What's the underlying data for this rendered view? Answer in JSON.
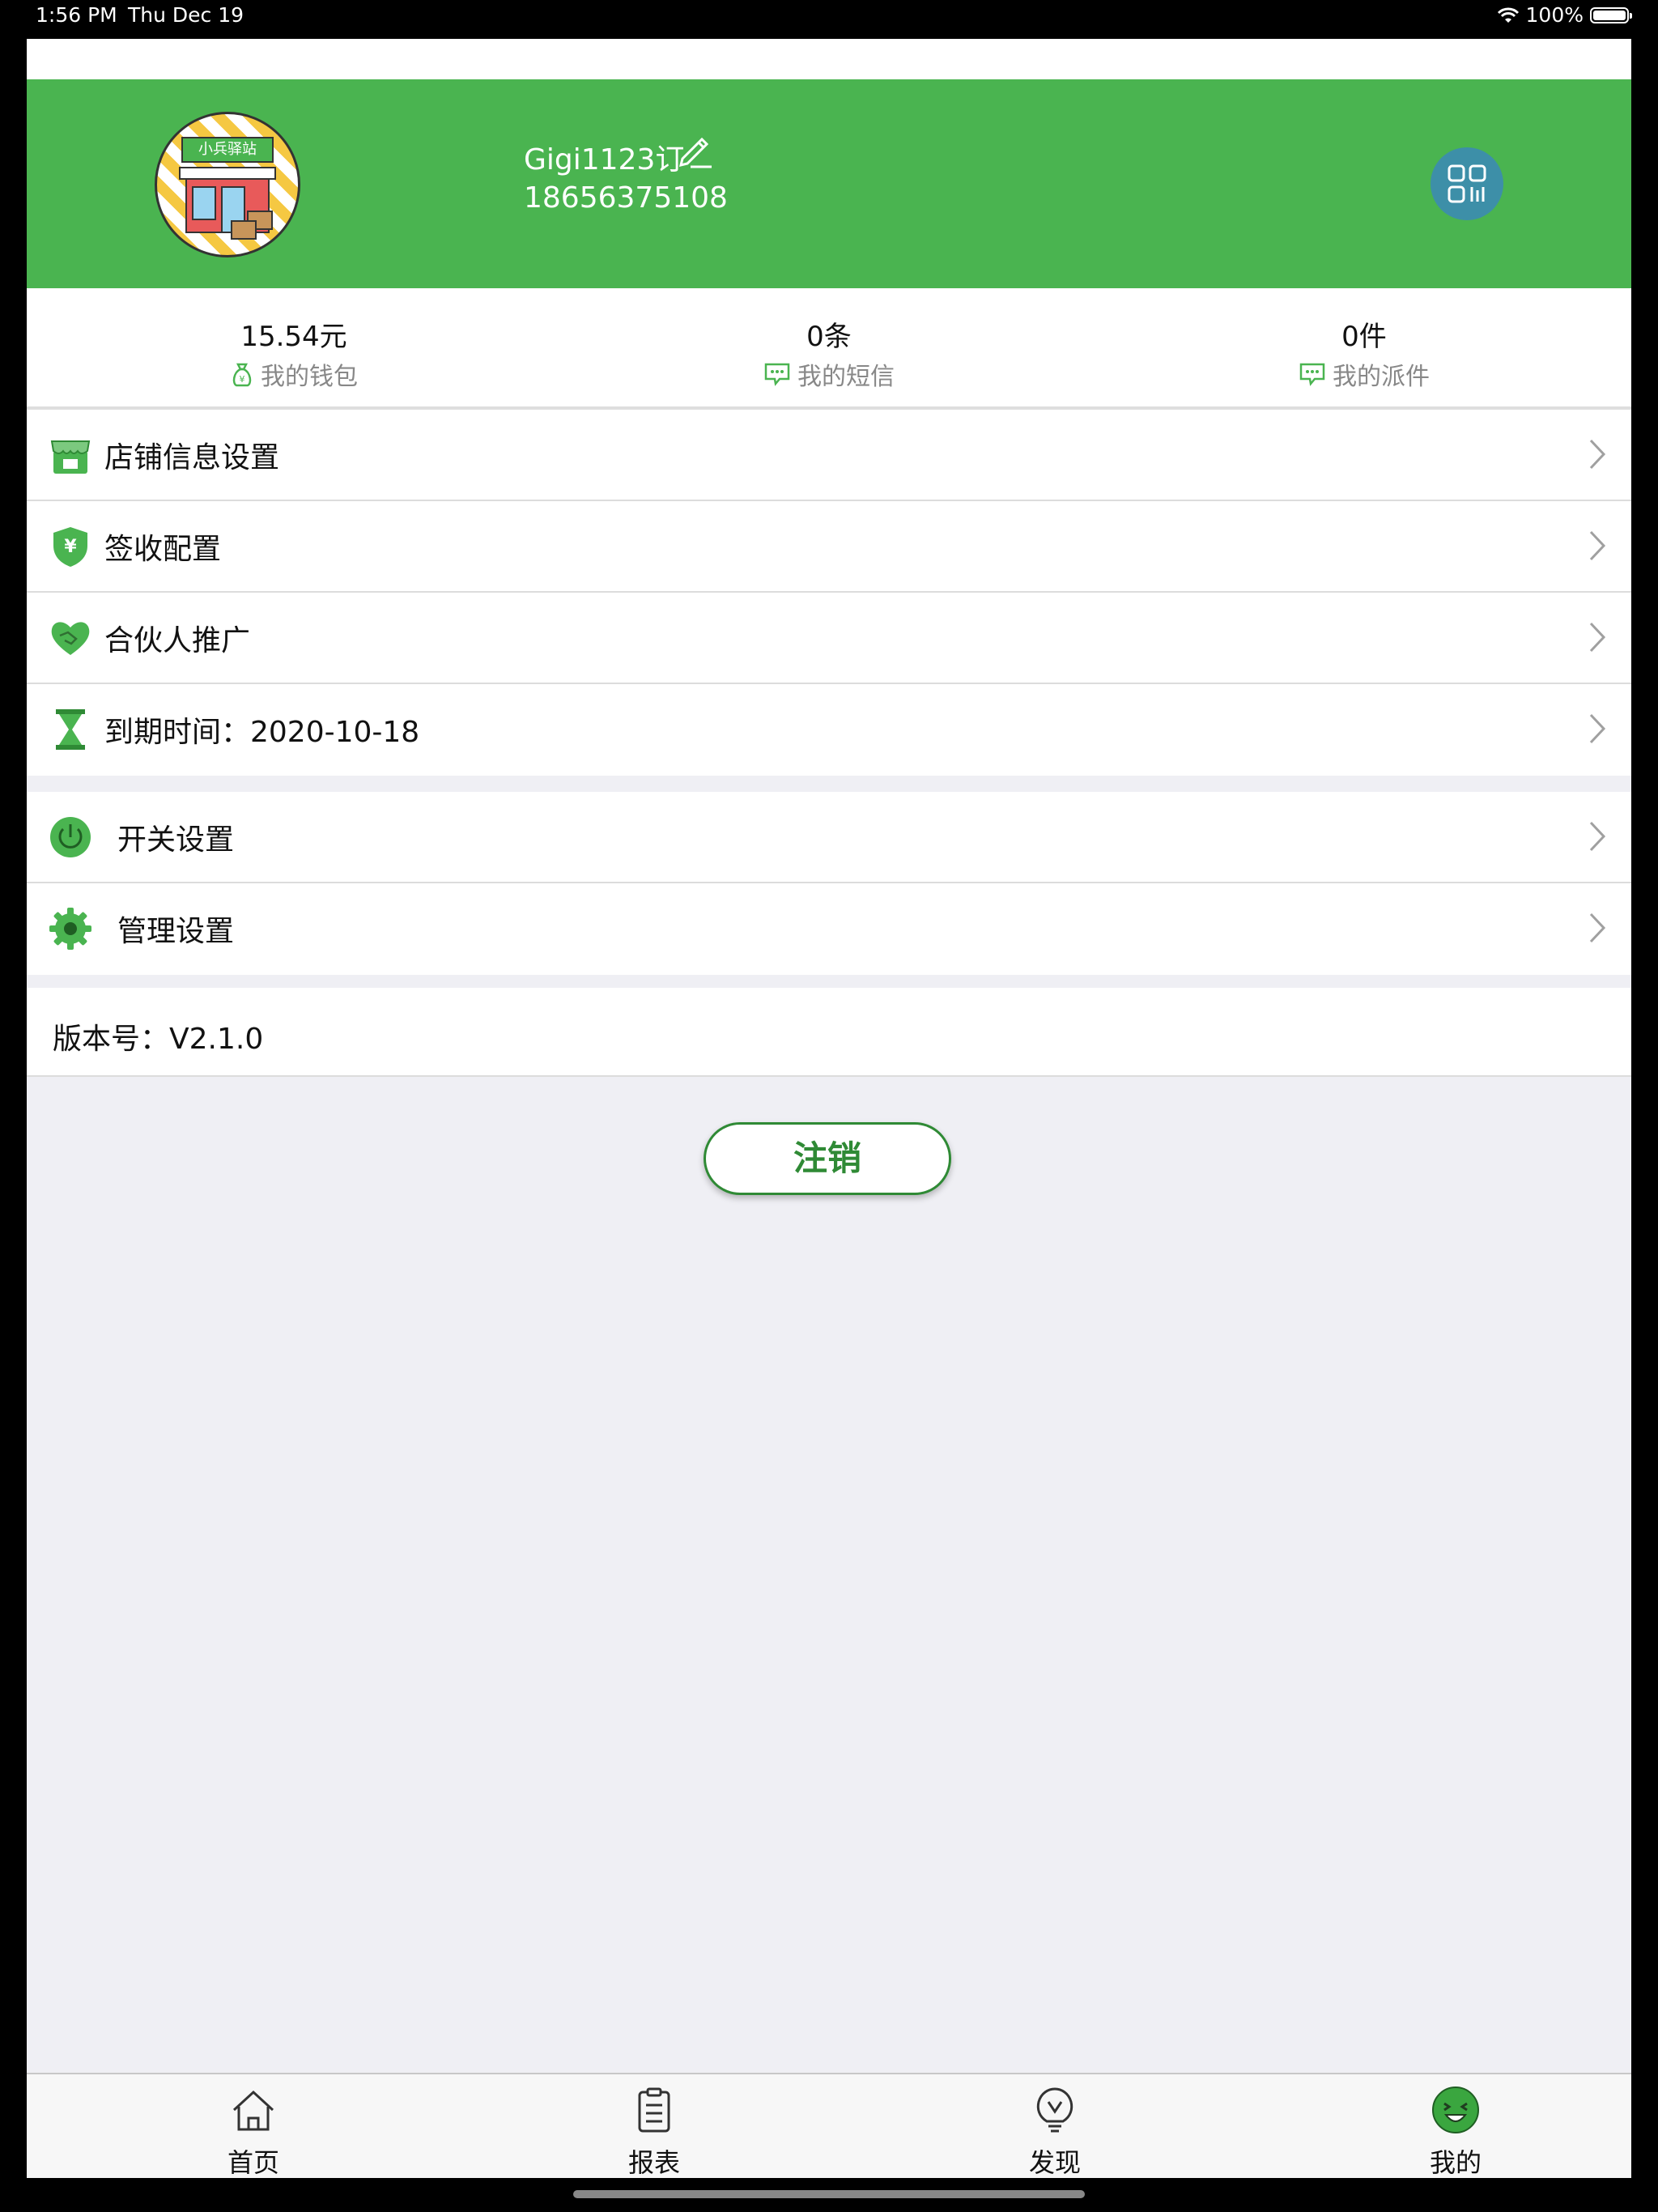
{
  "status_bar": {
    "time": "1:56 PM",
    "date": "Thu Dec 19",
    "battery": "100%"
  },
  "profile": {
    "avatar_text": "小兵驿站",
    "name": "Gigi1123订",
    "phone": "18656375108"
  },
  "stats": [
    {
      "value": "15.54元",
      "label": "我的钱包",
      "icon": "money-bag-icon"
    },
    {
      "value": "0条",
      "label": "我的短信",
      "icon": "message-icon"
    },
    {
      "value": "0件",
      "label": "我的派件",
      "icon": "message-icon"
    }
  ],
  "menu_group1": [
    {
      "label": "店铺信息设置",
      "icon": "store-icon"
    },
    {
      "label": "签收配置",
      "icon": "shield-yen-icon"
    },
    {
      "label": "合伙人推广",
      "icon": "handshake-heart-icon"
    },
    {
      "label": "到期时间：2020-10-18",
      "icon": "hourglass-icon"
    }
  ],
  "menu_group2": [
    {
      "label": "开关设置",
      "icon": "power-icon"
    },
    {
      "label": "管理设置",
      "icon": "gear-icon"
    }
  ],
  "version": "版本号：V2.1.0",
  "logout_label": "注销",
  "tabs": [
    {
      "label": "首页",
      "icon": "home-icon"
    },
    {
      "label": "报表",
      "icon": "clipboard-icon"
    },
    {
      "label": "发现",
      "icon": "lightbulb-icon"
    },
    {
      "label": "我的",
      "icon": "smiley-icon",
      "active": true
    }
  ],
  "colors": {
    "brand_green": "#4ab450",
    "dark_green": "#2f8a35",
    "qr_blue": "#3d8fa8",
    "background": "#efeff4"
  }
}
